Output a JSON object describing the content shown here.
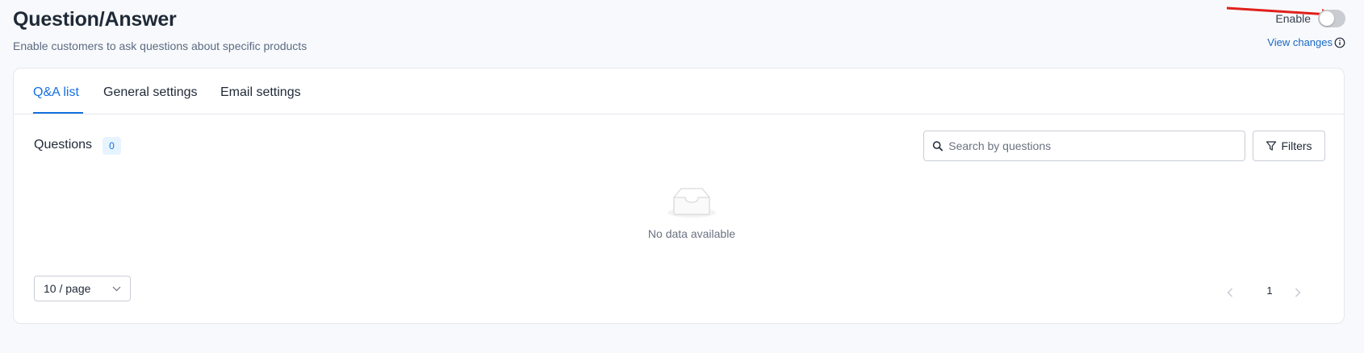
{
  "header": {
    "title": "Question/Answer",
    "subtitle": "Enable customers to ask questions about specific products",
    "enable_label": "Enable",
    "enable_on": false,
    "view_changes_label": "View changes"
  },
  "tabs": [
    {
      "label": "Q&A list",
      "active": true
    },
    {
      "label": "General settings",
      "active": false
    },
    {
      "label": "Email settings",
      "active": false
    }
  ],
  "questions": {
    "title": "Questions",
    "count": "0"
  },
  "search": {
    "placeholder": "Search by questions",
    "value": ""
  },
  "filters_label": "Filters",
  "empty_state": {
    "icon": "inbox-empty-icon",
    "text": "No data available"
  },
  "pagination": {
    "page_size": "10 / page",
    "current_page": "1"
  },
  "colors": {
    "accent": "#1570e0",
    "link": "#1769c5",
    "annotation_arrow": "#e0201b"
  }
}
